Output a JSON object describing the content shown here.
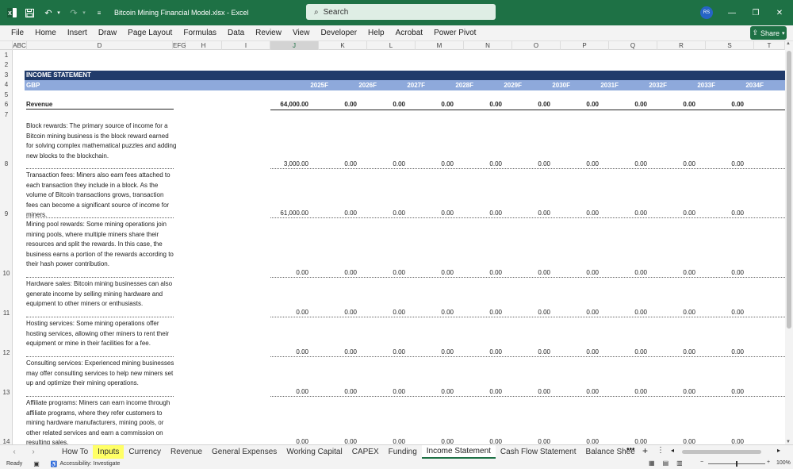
{
  "window": {
    "title": "Bitcoin Mining Financial Model.xlsx  -  Excel",
    "search_placeholder": "Search",
    "avatar_initials": "RS",
    "accent_color": "#1e7145"
  },
  "menu": [
    "File",
    "Home",
    "Insert",
    "Draw",
    "Page Layout",
    "Formulas",
    "Data",
    "Review",
    "View",
    "Developer",
    "Help",
    "Acrobat",
    "Power Pivot"
  ],
  "share_label": "Share",
  "columns": [
    "ABC",
    "D",
    "EFG",
    "H",
    "I",
    "J",
    "K",
    "L",
    "M",
    "N",
    "O",
    "P",
    "Q",
    "R",
    "S",
    "T"
  ],
  "rows": [
    "1",
    "2",
    "3",
    "4",
    "5",
    "6",
    "7",
    "8",
    "9",
    "10",
    "11",
    "12",
    "13",
    "14"
  ],
  "sheet": {
    "banner": "INCOME STATEMENT",
    "currency": "GBP",
    "years": [
      "2025F",
      "2026F",
      "2027F",
      "2028F",
      "2029F",
      "2030F",
      "2031F",
      "2032F",
      "2033F",
      "2034F"
    ],
    "revenue_label": "Revenue",
    "revenue_values": [
      "64,000.00",
      "0.00",
      "0.00",
      "0.00",
      "0.00",
      "0.00",
      "0.00",
      "0.00",
      "0.00",
      "0.00"
    ],
    "items": [
      {
        "desc": "Block rewards: The primary source of income for a Bitcoin mining business is the block reward earned for solving complex mathematical puzzles and adding new blocks to the blockchain.",
        "values": [
          "3,000.00",
          "0.00",
          "0.00",
          "0.00",
          "0.00",
          "0.00",
          "0.00",
          "0.00",
          "0.00",
          "0.00"
        ]
      },
      {
        "desc": "Transaction fees: Miners also earn fees attached to each transaction they include in a block. As the volume of Bitcoin transactions grows, transaction fees can become a significant source of income for miners.",
        "values": [
          "61,000.00",
          "0.00",
          "0.00",
          "0.00",
          "0.00",
          "0.00",
          "0.00",
          "0.00",
          "0.00",
          "0.00"
        ]
      },
      {
        "desc": "Mining pool rewards: Some mining operations join mining pools, where multiple miners share their resources and split the rewards. In this case, the business earns a portion of the rewards according to their hash power contribution.",
        "values": [
          "0.00",
          "0.00",
          "0.00",
          "0.00",
          "0.00",
          "0.00",
          "0.00",
          "0.00",
          "0.00",
          "0.00"
        ]
      },
      {
        "desc": "Hardware sales: Bitcoin mining businesses can also generate income by selling mining hardware and equipment to other miners or enthusiasts.",
        "values": [
          "0.00",
          "0.00",
          "0.00",
          "0.00",
          "0.00",
          "0.00",
          "0.00",
          "0.00",
          "0.00",
          "0.00"
        ]
      },
      {
        "desc": "Hosting services: Some mining operations offer hosting services, allowing other miners to rent their equipment or mine in their facilities for a fee.",
        "values": [
          "0.00",
          "0.00",
          "0.00",
          "0.00",
          "0.00",
          "0.00",
          "0.00",
          "0.00",
          "0.00",
          "0.00"
        ]
      },
      {
        "desc": "Consulting services: Experienced mining businesses may offer consulting services to help new miners set up and optimize their mining operations.",
        "values": [
          "0.00",
          "0.00",
          "0.00",
          "0.00",
          "0.00",
          "0.00",
          "0.00",
          "0.00",
          "0.00",
          "0.00"
        ]
      },
      {
        "desc": "Affiliate programs: Miners can earn income through affiliate programs, where they refer customers to mining hardware manufacturers, mining pools, or other related services and earn a commission on resulting sales.",
        "values": [
          "0.00",
          "0.00",
          "0.00",
          "0.00",
          "0.00",
          "0.00",
          "0.00",
          "0.00",
          "0.00",
          "0.00"
        ]
      }
    ]
  },
  "tabs": [
    {
      "label": "How To",
      "style": ""
    },
    {
      "label": "Inputs",
      "style": "yellow"
    },
    {
      "label": "Currency",
      "style": ""
    },
    {
      "label": "Revenue",
      "style": ""
    },
    {
      "label": "General Expenses",
      "style": ""
    },
    {
      "label": "Working Capital",
      "style": ""
    },
    {
      "label": "CAPEX",
      "style": ""
    },
    {
      "label": "Funding",
      "style": ""
    },
    {
      "label": "Income Statement",
      "style": "active"
    },
    {
      "label": "Cash Flow Statement",
      "style": ""
    },
    {
      "label": "Balance Shee",
      "style": ""
    }
  ],
  "status": {
    "ready": "Ready",
    "accessibility": "Accessibility: Investigate",
    "zoom": "100%"
  }
}
